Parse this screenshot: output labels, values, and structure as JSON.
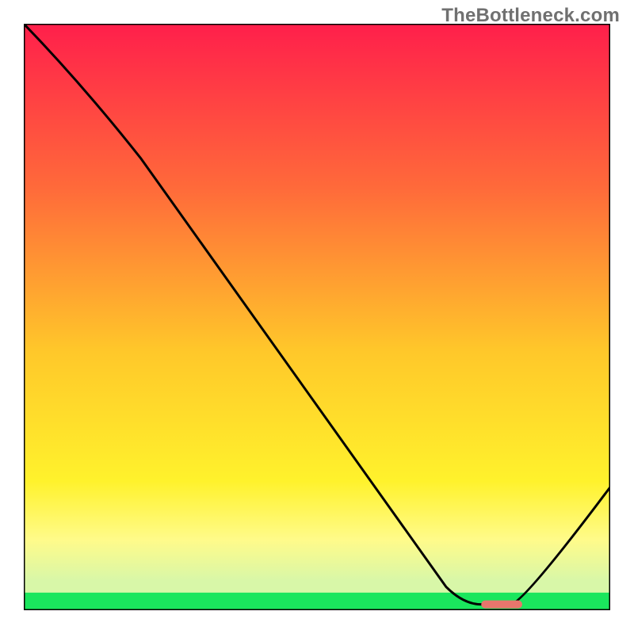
{
  "watermark": "TheBottleneck.com",
  "chart_data": {
    "type": "line",
    "title": "",
    "xlabel": "",
    "ylabel": "",
    "xlim": [
      0,
      100
    ],
    "ylim": [
      0,
      100
    ],
    "grid": false,
    "legend": false,
    "series": [
      {
        "name": "curve",
        "x": [
          0,
          20,
          72,
          78,
          83,
          85,
          100
        ],
        "y": [
          100,
          77,
          4,
          1,
          1,
          1,
          21
        ]
      }
    ],
    "marker": {
      "name": "optimum-range",
      "x_start": 78,
      "x_end": 85,
      "y": 1,
      "color": "#e8766c"
    },
    "background": {
      "type": "vertical-gradient-with-green-band",
      "stops": [
        {
          "pos": 0.0,
          "color": "#ff1f4b"
        },
        {
          "pos": 0.28,
          "color": "#ff6a3a"
        },
        {
          "pos": 0.56,
          "color": "#ffc82a"
        },
        {
          "pos": 0.78,
          "color": "#fff22c"
        },
        {
          "pos": 0.88,
          "color": "#fffb8a"
        },
        {
          "pos": 0.95,
          "color": "#d8f7a8"
        }
      ],
      "green_band": {
        "from": 0.97,
        "to": 1.0,
        "color": "#1ae65d"
      }
    }
  }
}
